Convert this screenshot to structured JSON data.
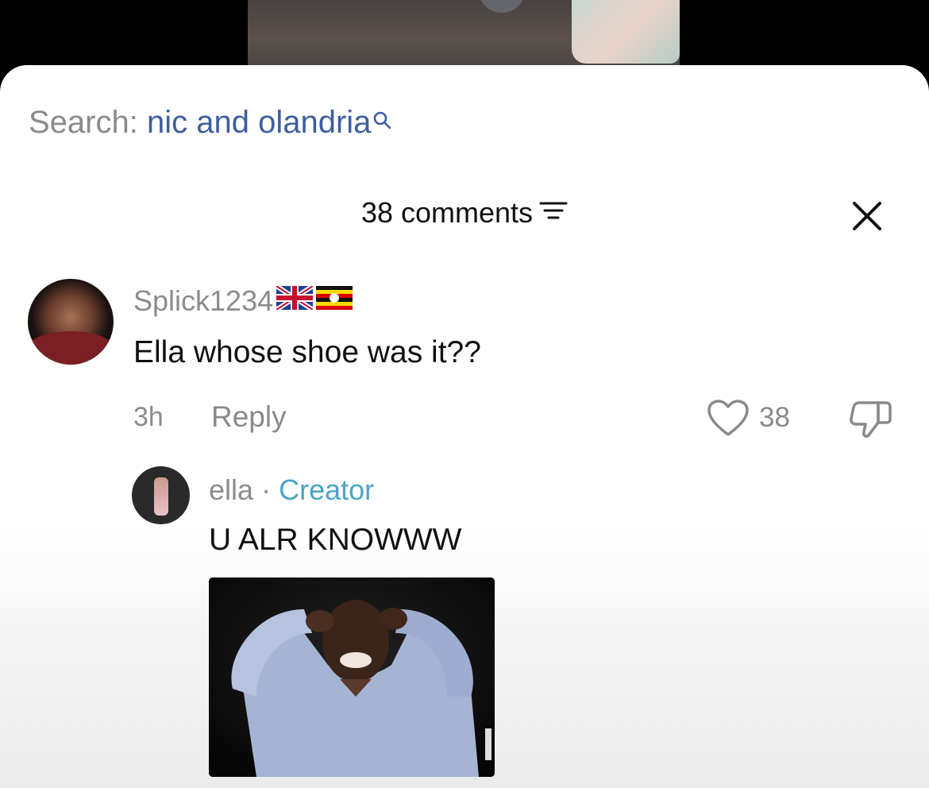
{
  "search": {
    "prefix": "Search:",
    "query": "nic and olandria"
  },
  "comments_header": {
    "title": "38 comments"
  },
  "comments": [
    {
      "username": "Splick1234",
      "flags": [
        "uk-flag",
        "uganda-flag"
      ],
      "text": "Ella whose shoe was it??",
      "time": "3h",
      "reply_label": "Reply",
      "likes": "38"
    }
  ],
  "reply": {
    "username": "ella",
    "separator": "·",
    "badge": "Creator",
    "text": "U ALR KNOWWW"
  },
  "colors": {
    "search_query": "#3d5e9e",
    "creator_badge": "#4ca4c8",
    "muted_text": "#8c8c8c"
  }
}
